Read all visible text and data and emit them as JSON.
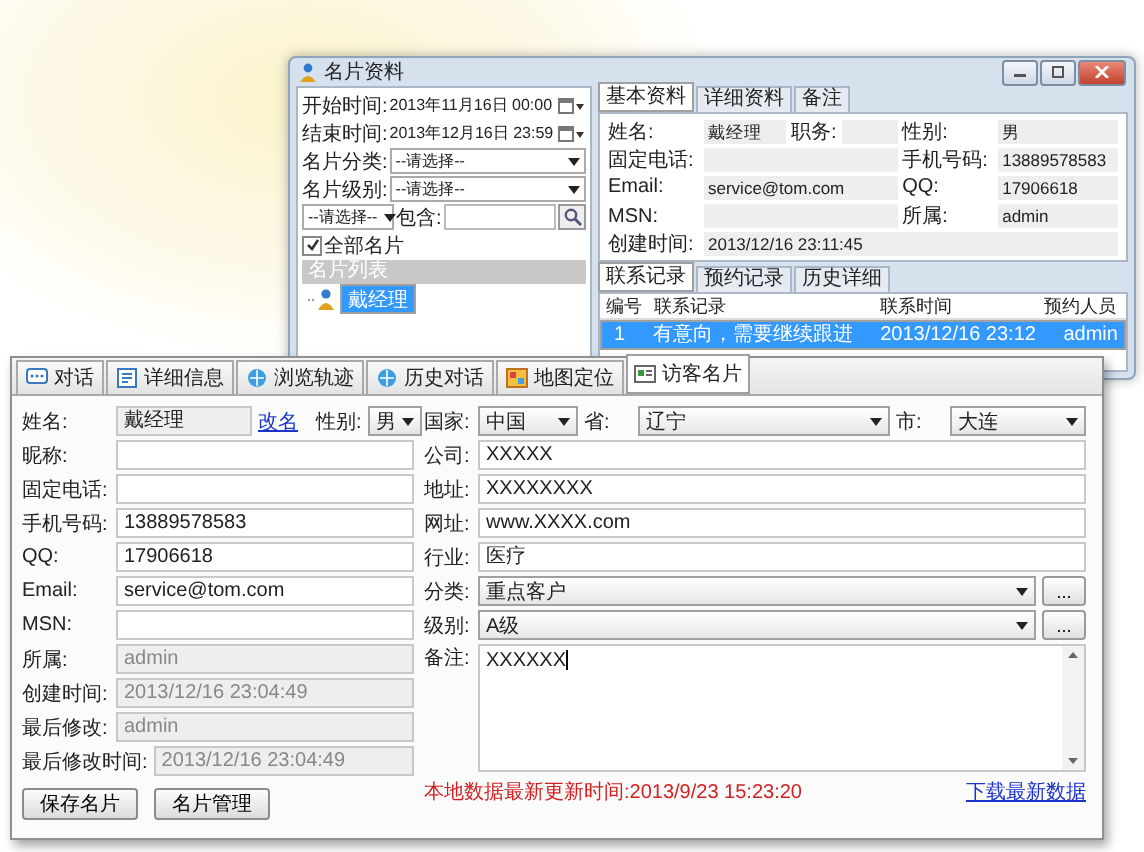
{
  "back_window": {
    "title": "名片资料",
    "filters": [
      {
        "kind": "date",
        "label": "开始时间:",
        "value": "2013年11月16日 00:00"
      },
      {
        "kind": "date",
        "label": "结束时间:",
        "value": "2013年12月16日 23:59"
      },
      {
        "kind": "select",
        "label": "名片分类:",
        "value": "--请选择--"
      },
      {
        "kind": "select",
        "label": "名片级别:",
        "value": "--请选择--"
      }
    ],
    "search": {
      "field_select": "--请选择--",
      "contains_label": "包含:"
    },
    "all_cards": {
      "label": "全部名片",
      "checked": true
    },
    "list_header": "名片列表",
    "card_tree": [
      {
        "label": "戴经理",
        "selected": true
      }
    ],
    "tabs": [
      {
        "label": "基本资料",
        "selected": true
      },
      {
        "label": "详细资料",
        "selected": false
      },
      {
        "label": "备注",
        "selected": false
      }
    ],
    "field_rows": [
      [
        {
          "label": "姓名:",
          "value": "戴经理"
        },
        {
          "label": "职务:"
        },
        {
          "label": "性别:",
          "value": "男"
        }
      ],
      [
        {
          "label": "固定电话:"
        },
        {
          "label": "手机号码:",
          "value": "13889578583"
        }
      ],
      [
        {
          "label": "Email:",
          "value": "service@tom.com"
        },
        {
          "label": "QQ:",
          "value": "17906618"
        }
      ],
      [
        {
          "label": "MSN:"
        },
        {
          "label": "所属:",
          "value": "admin"
        }
      ],
      [
        {
          "label": "创建时间:",
          "value": "2013/12/16 23:11:45"
        }
      ]
    ],
    "record_tabs": [
      {
        "label": "联系记录",
        "selected": true
      },
      {
        "label": "预约记录",
        "selected": false
      },
      {
        "label": "历史详细",
        "selected": false
      }
    ],
    "table": {
      "columns": [
        "编号",
        "联系记录",
        "联系时间",
        "预约人员"
      ],
      "rows": [
        {
          "cells": [
            "1",
            "有意向，需要继续跟进",
            "2013/12/16 23:12",
            "admin"
          ],
          "selected": true
        }
      ]
    }
  },
  "front_window": {
    "tabs": [
      {
        "label": "对话",
        "selected": false
      },
      {
        "label": "详细信息",
        "selected": false
      },
      {
        "label": "浏览轨迹",
        "selected": false
      },
      {
        "label": "历史对话",
        "selected": false
      },
      {
        "label": "地图定位",
        "selected": false
      },
      {
        "label": "访客名片",
        "selected": true
      }
    ],
    "name_row": {
      "label": "姓名:",
      "value": "戴经理",
      "disabled": true,
      "rename_link": "改名",
      "gender_label": "性别:",
      "gender": "男"
    },
    "left_fields": [
      {
        "label": "昵称:",
        "disabled": false
      },
      {
        "label": "固定电话:",
        "disabled": false
      },
      {
        "label": "手机号码:",
        "value": "13889578583",
        "disabled": false
      },
      {
        "label": "QQ:",
        "value": "17906618",
        "disabled": false
      },
      {
        "label": "Email:",
        "value": "service@tom.com",
        "disabled": false
      },
      {
        "label": "MSN:",
        "disabled": false
      },
      {
        "label": "所属:",
        "value": "admin",
        "disabled": true
      },
      {
        "label": "创建时间:",
        "value": "2013/12/16 23:04:49",
        "disabled": true
      },
      {
        "label": "最后修改:",
        "value": "admin",
        "disabled": true
      },
      {
        "label": "最后修改时间:",
        "value": "2013/12/16 23:04:49",
        "disabled": true
      }
    ],
    "location": [
      {
        "label": "国家:",
        "value": "中国"
      },
      {
        "label": "省:",
        "value": "辽宁"
      },
      {
        "label": "市:",
        "value": "大连"
      }
    ],
    "right_fields": [
      {
        "kind": "text",
        "label": "公司:",
        "value": "XXXXX"
      },
      {
        "kind": "text",
        "label": "地址:",
        "value": "XXXXXXXX"
      },
      {
        "kind": "text",
        "label": "网址:",
        "value": "www.XXXX.com"
      },
      {
        "kind": "text",
        "label": "行业:",
        "value": "医疗"
      },
      {
        "kind": "select",
        "label": "分类:",
        "value": "重点客户",
        "more_button": "..."
      },
      {
        "kind": "select",
        "label": "级别:",
        "value": "A级",
        "more_button": "..."
      },
      {
        "kind": "textarea",
        "label": "备注:",
        "value": "XXXXXX"
      }
    ],
    "buttons": [
      "保存名片",
      "名片管理"
    ],
    "status": {
      "text": "本地数据最新更新时间:2013/9/23 15:23:20",
      "link": "下载最新数据"
    }
  }
}
